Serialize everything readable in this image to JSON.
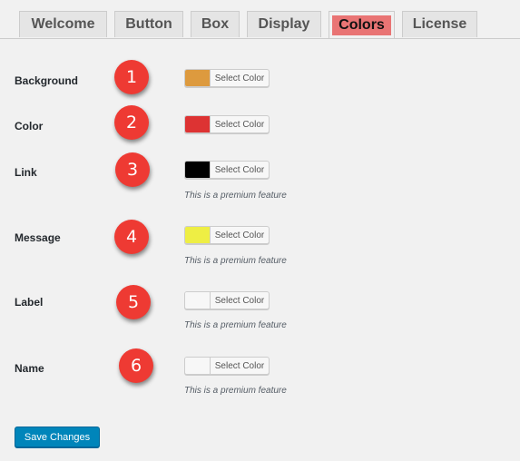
{
  "tabs": [
    {
      "label": "Welcome"
    },
    {
      "label": "Button"
    },
    {
      "label": "Box"
    },
    {
      "label": "Display"
    },
    {
      "label": "Colors"
    },
    {
      "label": "License"
    }
  ],
  "active_tab": "Colors",
  "select_color_label": "Select Color",
  "premium_note": "This is a premium feature",
  "rows": [
    {
      "label": "Background",
      "badge": "1",
      "swatch": "#dd9a3e",
      "premium": false
    },
    {
      "label": "Color",
      "badge": "2",
      "swatch": "#dd3333",
      "premium": false
    },
    {
      "label": "Link",
      "badge": "3",
      "swatch": "#000000",
      "premium": true
    },
    {
      "label": "Message",
      "badge": "4",
      "swatch": "#eeee44",
      "premium": true
    },
    {
      "label": "Label",
      "badge": "5",
      "swatch": "#f7f7f7",
      "premium": true
    },
    {
      "label": "Name",
      "badge": "6",
      "swatch": "#f7f7f7",
      "premium": true
    }
  ],
  "save_label": "Save Changes",
  "colors": {
    "accent": "#0085ba",
    "active_tab_highlight": "#e97474",
    "badge": "#ee3a33"
  }
}
